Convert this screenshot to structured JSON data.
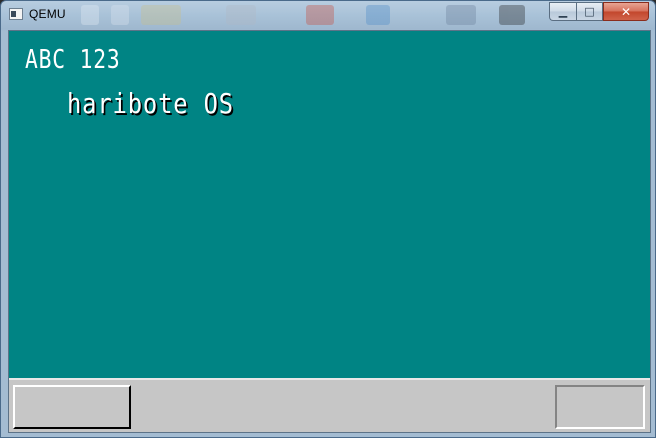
{
  "window": {
    "title": "QEMU",
    "minimize_glyph": "▁",
    "maximize_glyph": "□",
    "close_glyph": "✕"
  },
  "screen": {
    "background_color": "#008484",
    "line1": "ABC 123",
    "line2": "haribote OS"
  },
  "taskbar": {
    "background_color": "#c6c6c6"
  },
  "icons": {
    "app": "qemu-window-icon",
    "minimize": "minimize-icon",
    "maximize": "maximize-icon",
    "close": "close-icon"
  }
}
